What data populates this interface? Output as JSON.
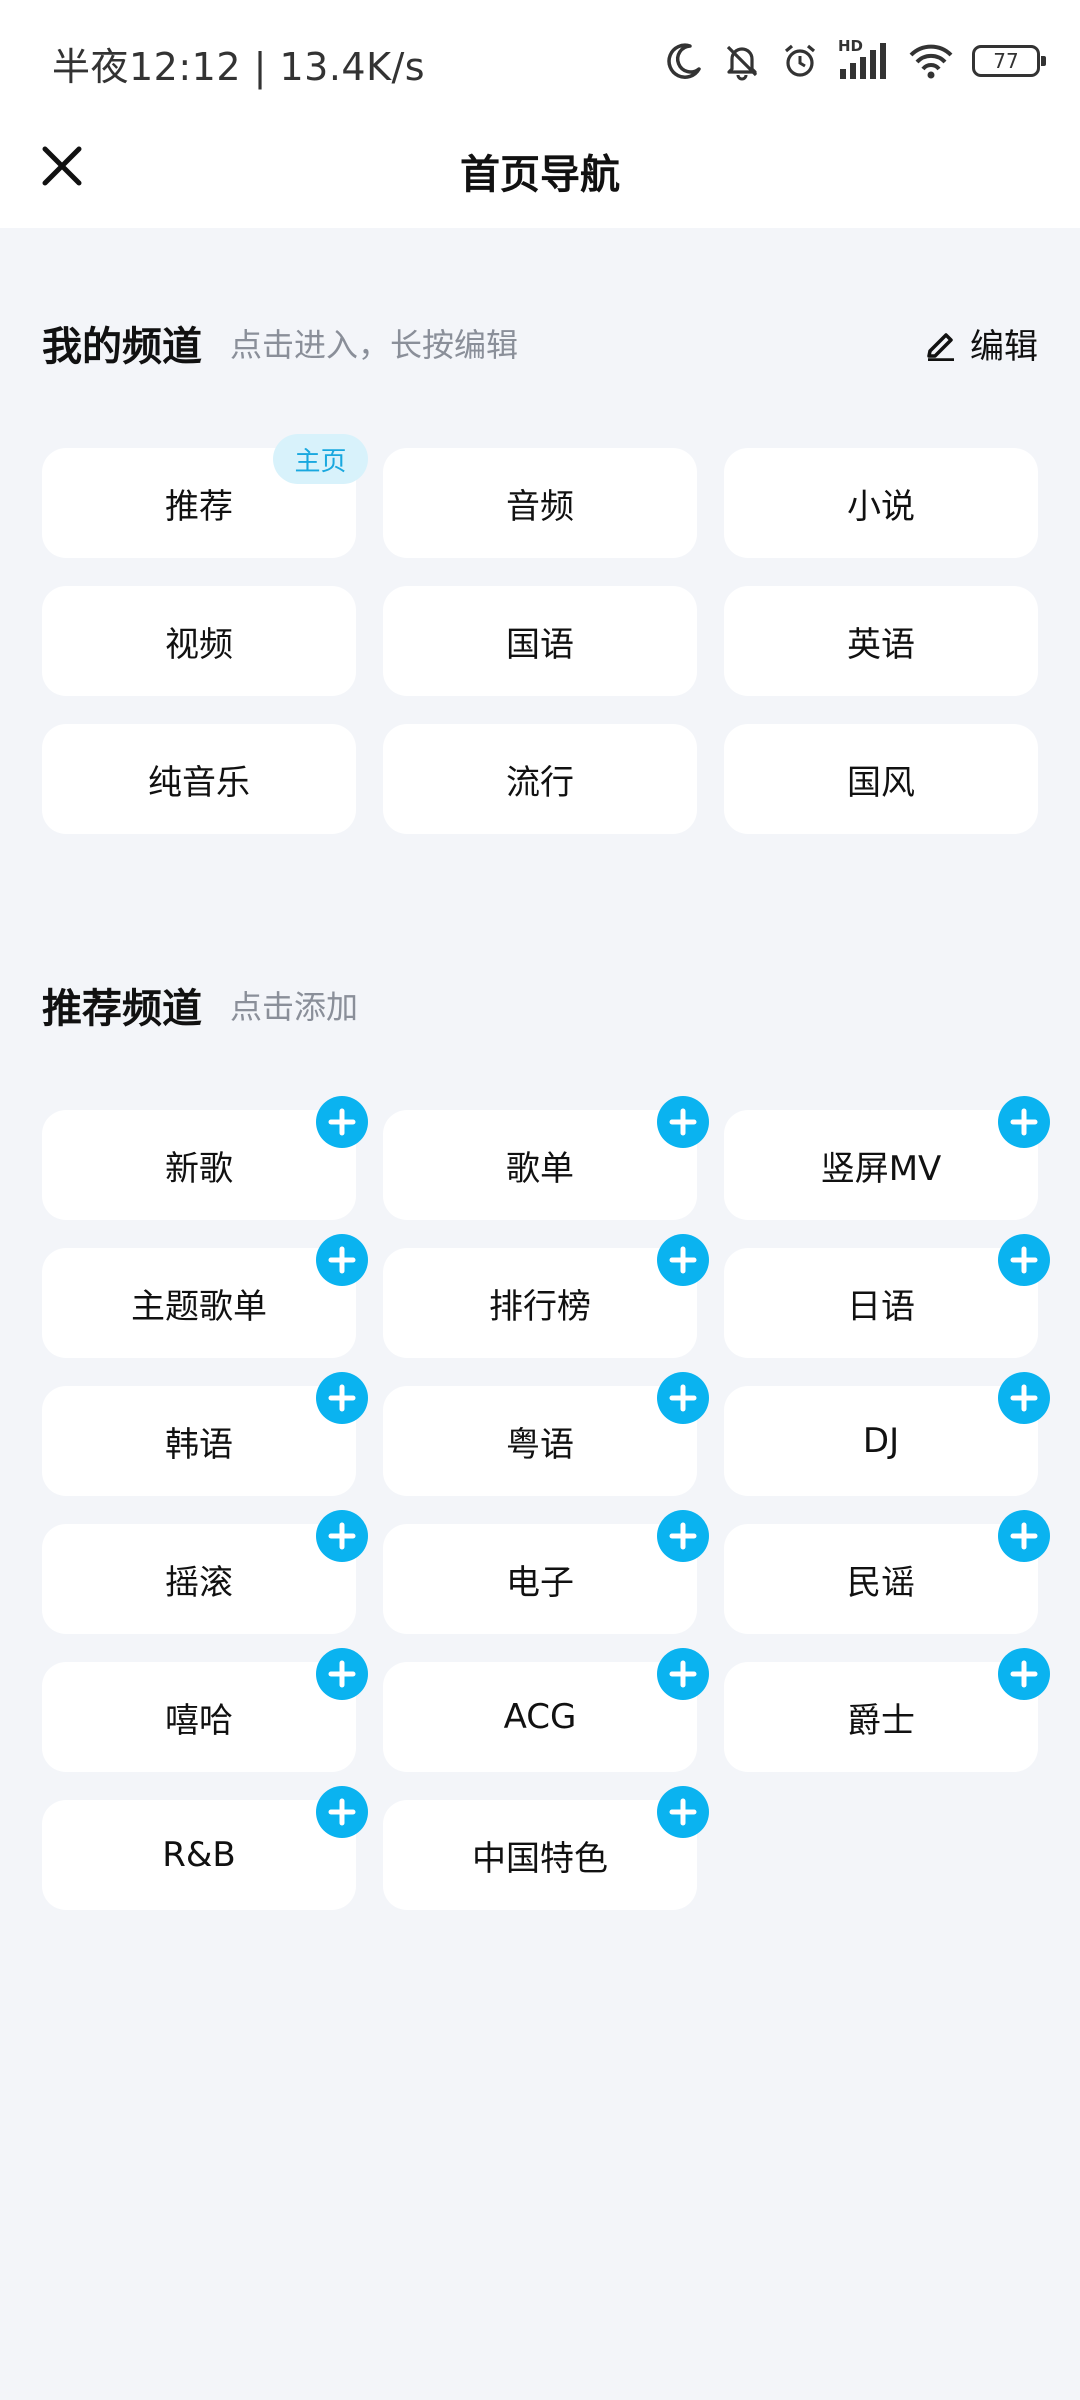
{
  "status_bar": {
    "time": "半夜12:12 | 13.4K/s",
    "network_label": "HD",
    "battery": "77",
    "icons": [
      "moon-icon",
      "bell-off-icon",
      "alarm-icon",
      "signal-icon",
      "wifi-icon",
      "battery-icon"
    ]
  },
  "nav": {
    "title": "首页导航",
    "close_icon": "close-icon"
  },
  "my_channels": {
    "title": "我的频道",
    "hint": "点击进入，长按编辑",
    "edit_label": "编辑",
    "home_badge": "主页",
    "items": [
      {
        "label": "推荐"
      },
      {
        "label": "音频"
      },
      {
        "label": "小说"
      },
      {
        "label": "视频"
      },
      {
        "label": "国语"
      },
      {
        "label": "英语"
      },
      {
        "label": "纯音乐"
      },
      {
        "label": "流行"
      },
      {
        "label": "国风"
      }
    ]
  },
  "recommended_channels": {
    "title": "推荐频道",
    "hint": "点击添加",
    "items": [
      {
        "label": "新歌"
      },
      {
        "label": "歌单"
      },
      {
        "label": "竖屏MV"
      },
      {
        "label": "主题歌单"
      },
      {
        "label": "排行榜"
      },
      {
        "label": "日语"
      },
      {
        "label": "韩语"
      },
      {
        "label": "粤语"
      },
      {
        "label": "DJ"
      },
      {
        "label": "摇滚"
      },
      {
        "label": "电子"
      },
      {
        "label": "民谣"
      },
      {
        "label": "嘻哈"
      },
      {
        "label": "ACG"
      },
      {
        "label": "爵士"
      },
      {
        "label": "R&B"
      },
      {
        "label": "中国特色"
      }
    ]
  },
  "colors": {
    "background": "#f3f5f9",
    "accent": "#0ab3f0",
    "badge_bg": "#d8f2fb",
    "hint": "#8a8f99"
  }
}
